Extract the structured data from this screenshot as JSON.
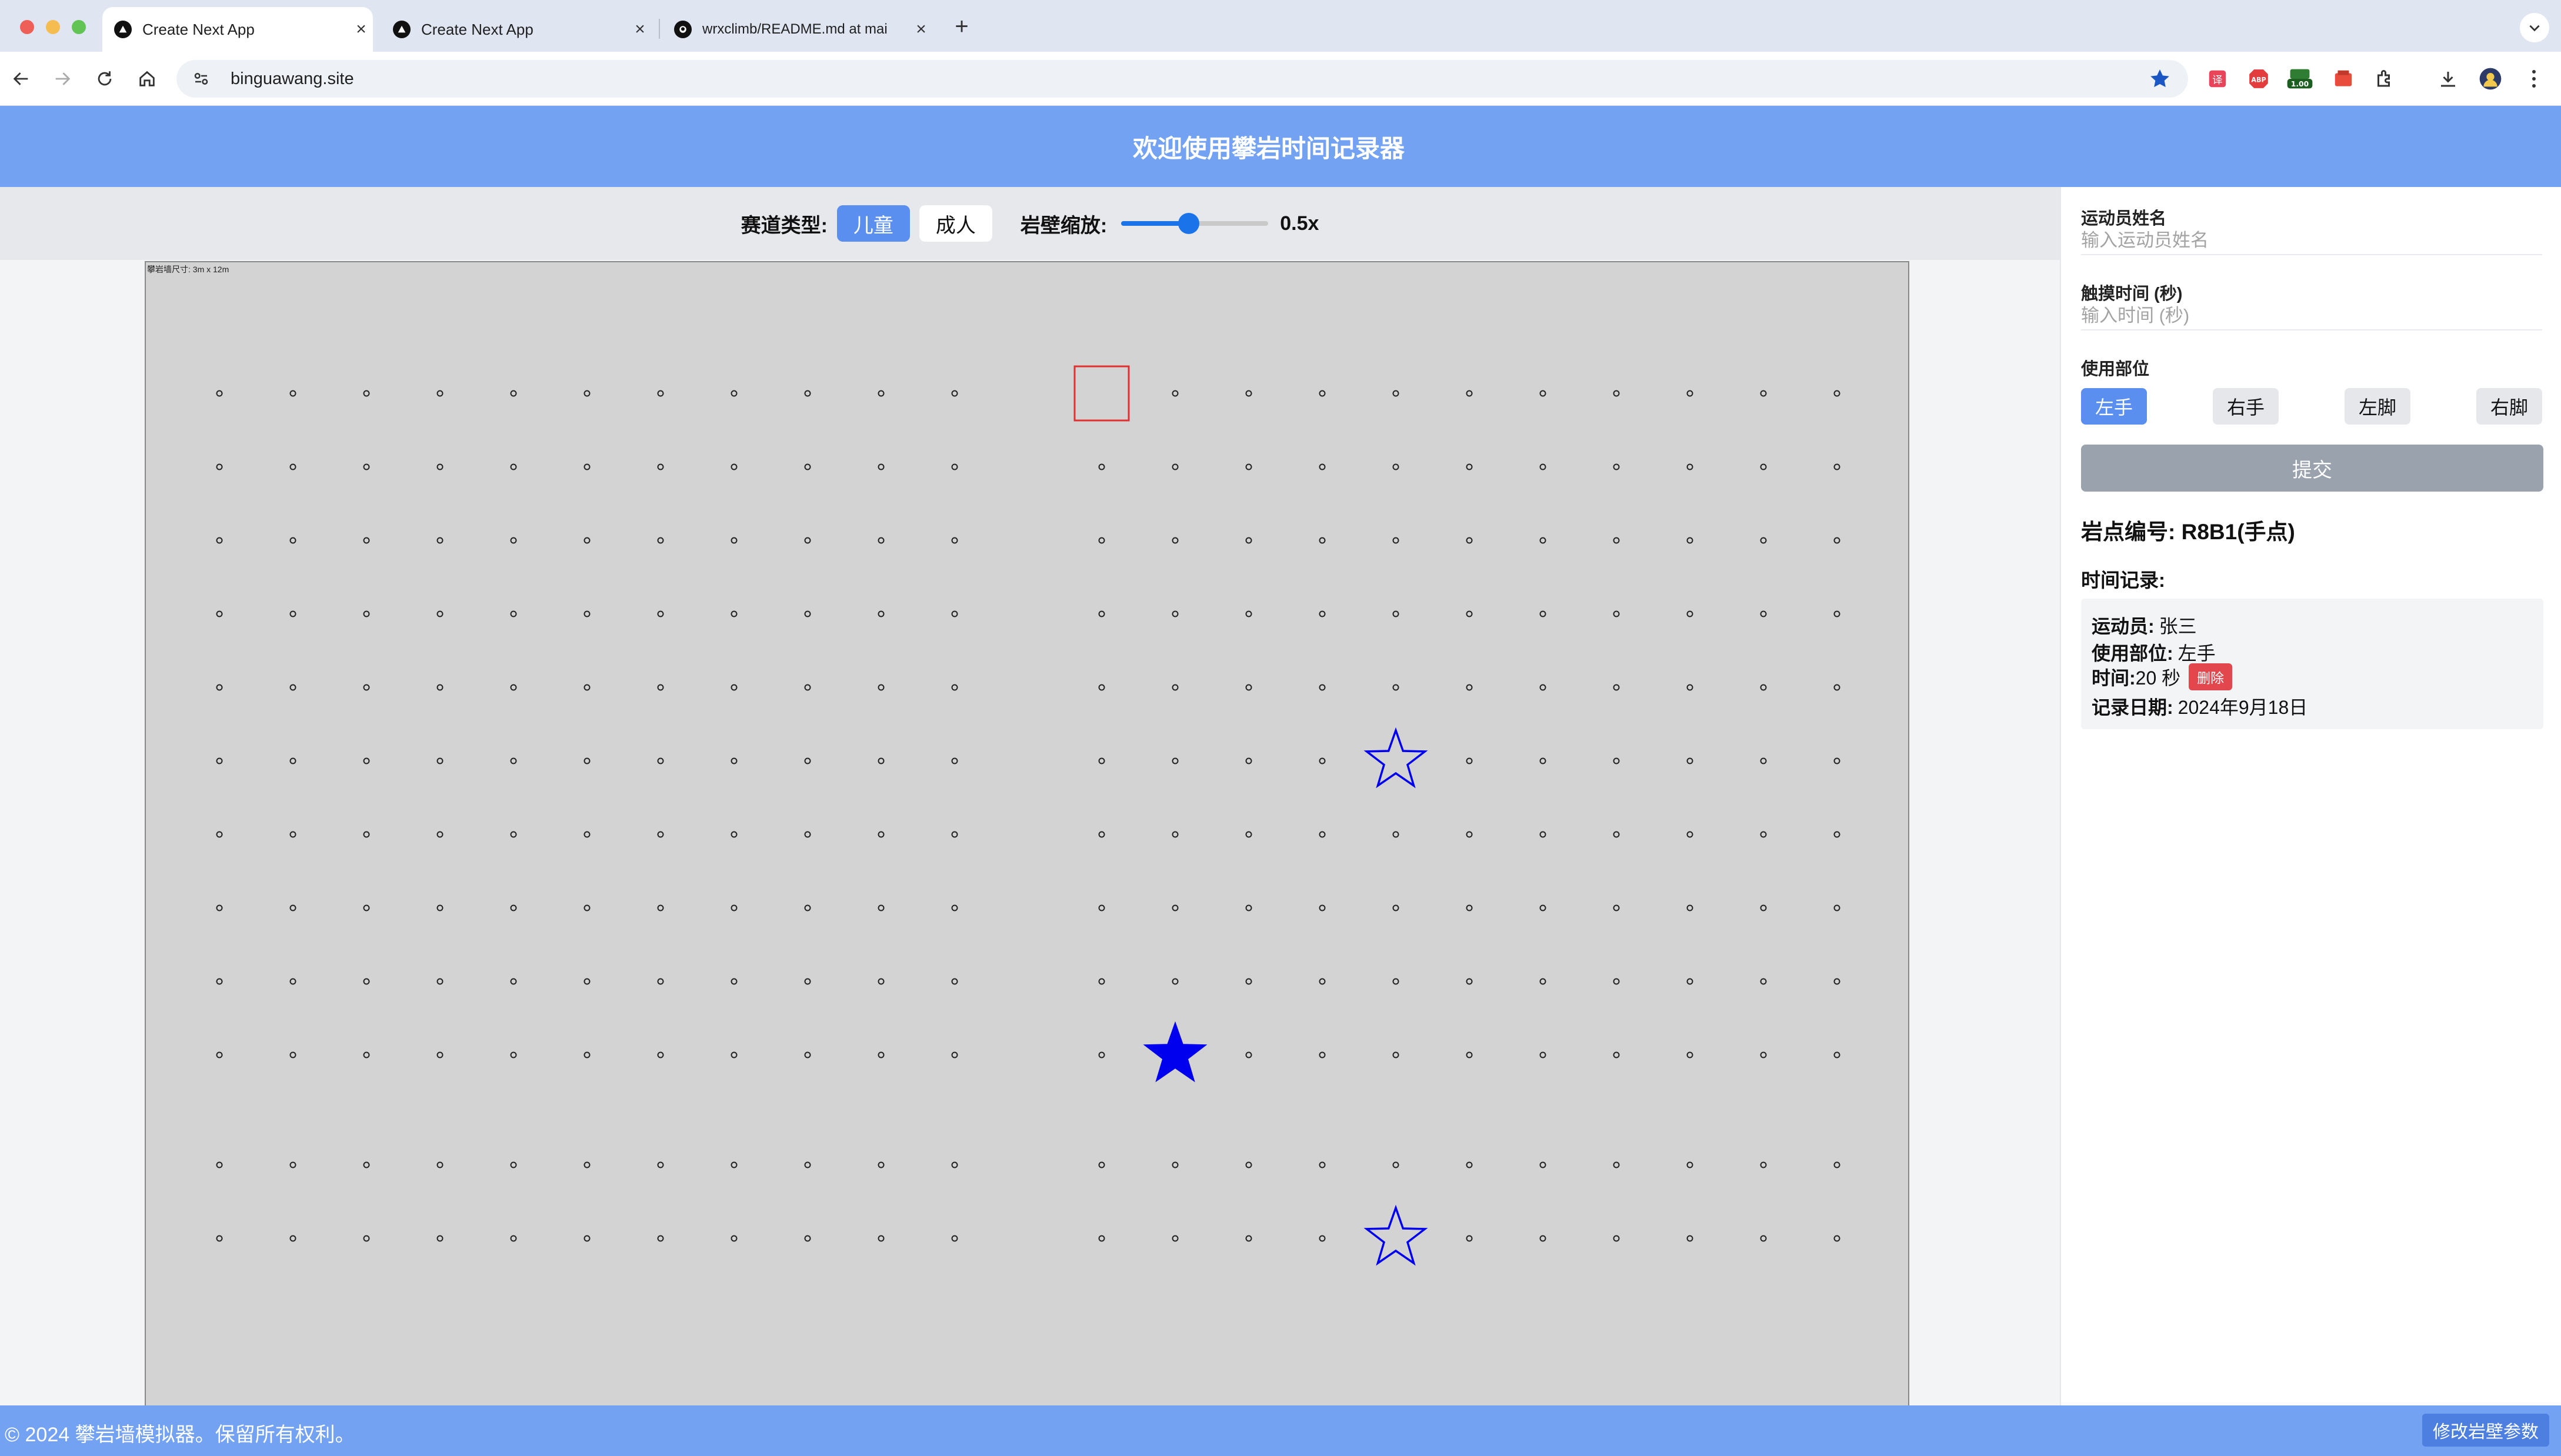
{
  "browser": {
    "tabs": [
      {
        "title": "Create Next App",
        "active": true
      },
      {
        "title": "Create Next App",
        "active": false
      },
      {
        "title": "wrxclimb/README.md at mai",
        "active": false
      }
    ],
    "url": "binguawang.site",
    "extension_badge": "1.00"
  },
  "app": {
    "title": "欢迎使用攀岩时间记录器"
  },
  "controls": {
    "track_type_label": "赛道类型:",
    "track_types": [
      "儿童",
      "成人"
    ],
    "selected_track_type": "儿童",
    "zoom_label": "岩壁缩放:",
    "zoom_value_text": "0.5x",
    "zoom_slider_fraction": 0.45
  },
  "wall": {
    "size_label": "攀岩墙尺寸: 3m x 12m",
    "selected_hold": {
      "row": 1,
      "col": 13
    },
    "markers": [
      {
        "row": 6,
        "col": 17,
        "type": "star-outline"
      },
      {
        "row": 10,
        "col": 14,
        "type": "star-filled"
      },
      {
        "row": 14,
        "col": 17,
        "type": "star-outline"
      }
    ],
    "accent_color": "#0000ee",
    "selection_color": "#e03030"
  },
  "form": {
    "name_label": "运动员姓名",
    "name_placeholder": "输入运动员姓名",
    "time_label": "触摸时间 (秒)",
    "time_placeholder": "输入时间 (秒)",
    "part_label": "使用部位",
    "parts": [
      "左手",
      "右手",
      "左脚",
      "右脚"
    ],
    "selected_part": "左手",
    "submit_label": "提交"
  },
  "hold_info": {
    "text": "岩点编号: R8B1(手点)"
  },
  "records": {
    "title": "时间记录:",
    "items": [
      {
        "athlete_label": "运动员:",
        "athlete": "张三",
        "part_label": "使用部位:",
        "part": "左手",
        "time_label": "时间:",
        "time": "20 秒",
        "delete_label": "删除",
        "date_label": "记录日期:",
        "date": "2024年9月18日"
      }
    ]
  },
  "footer": {
    "copyright": "© 2024 攀岩墙模拟器。保留所有权利。",
    "edit_button": "修改岩壁参数"
  }
}
